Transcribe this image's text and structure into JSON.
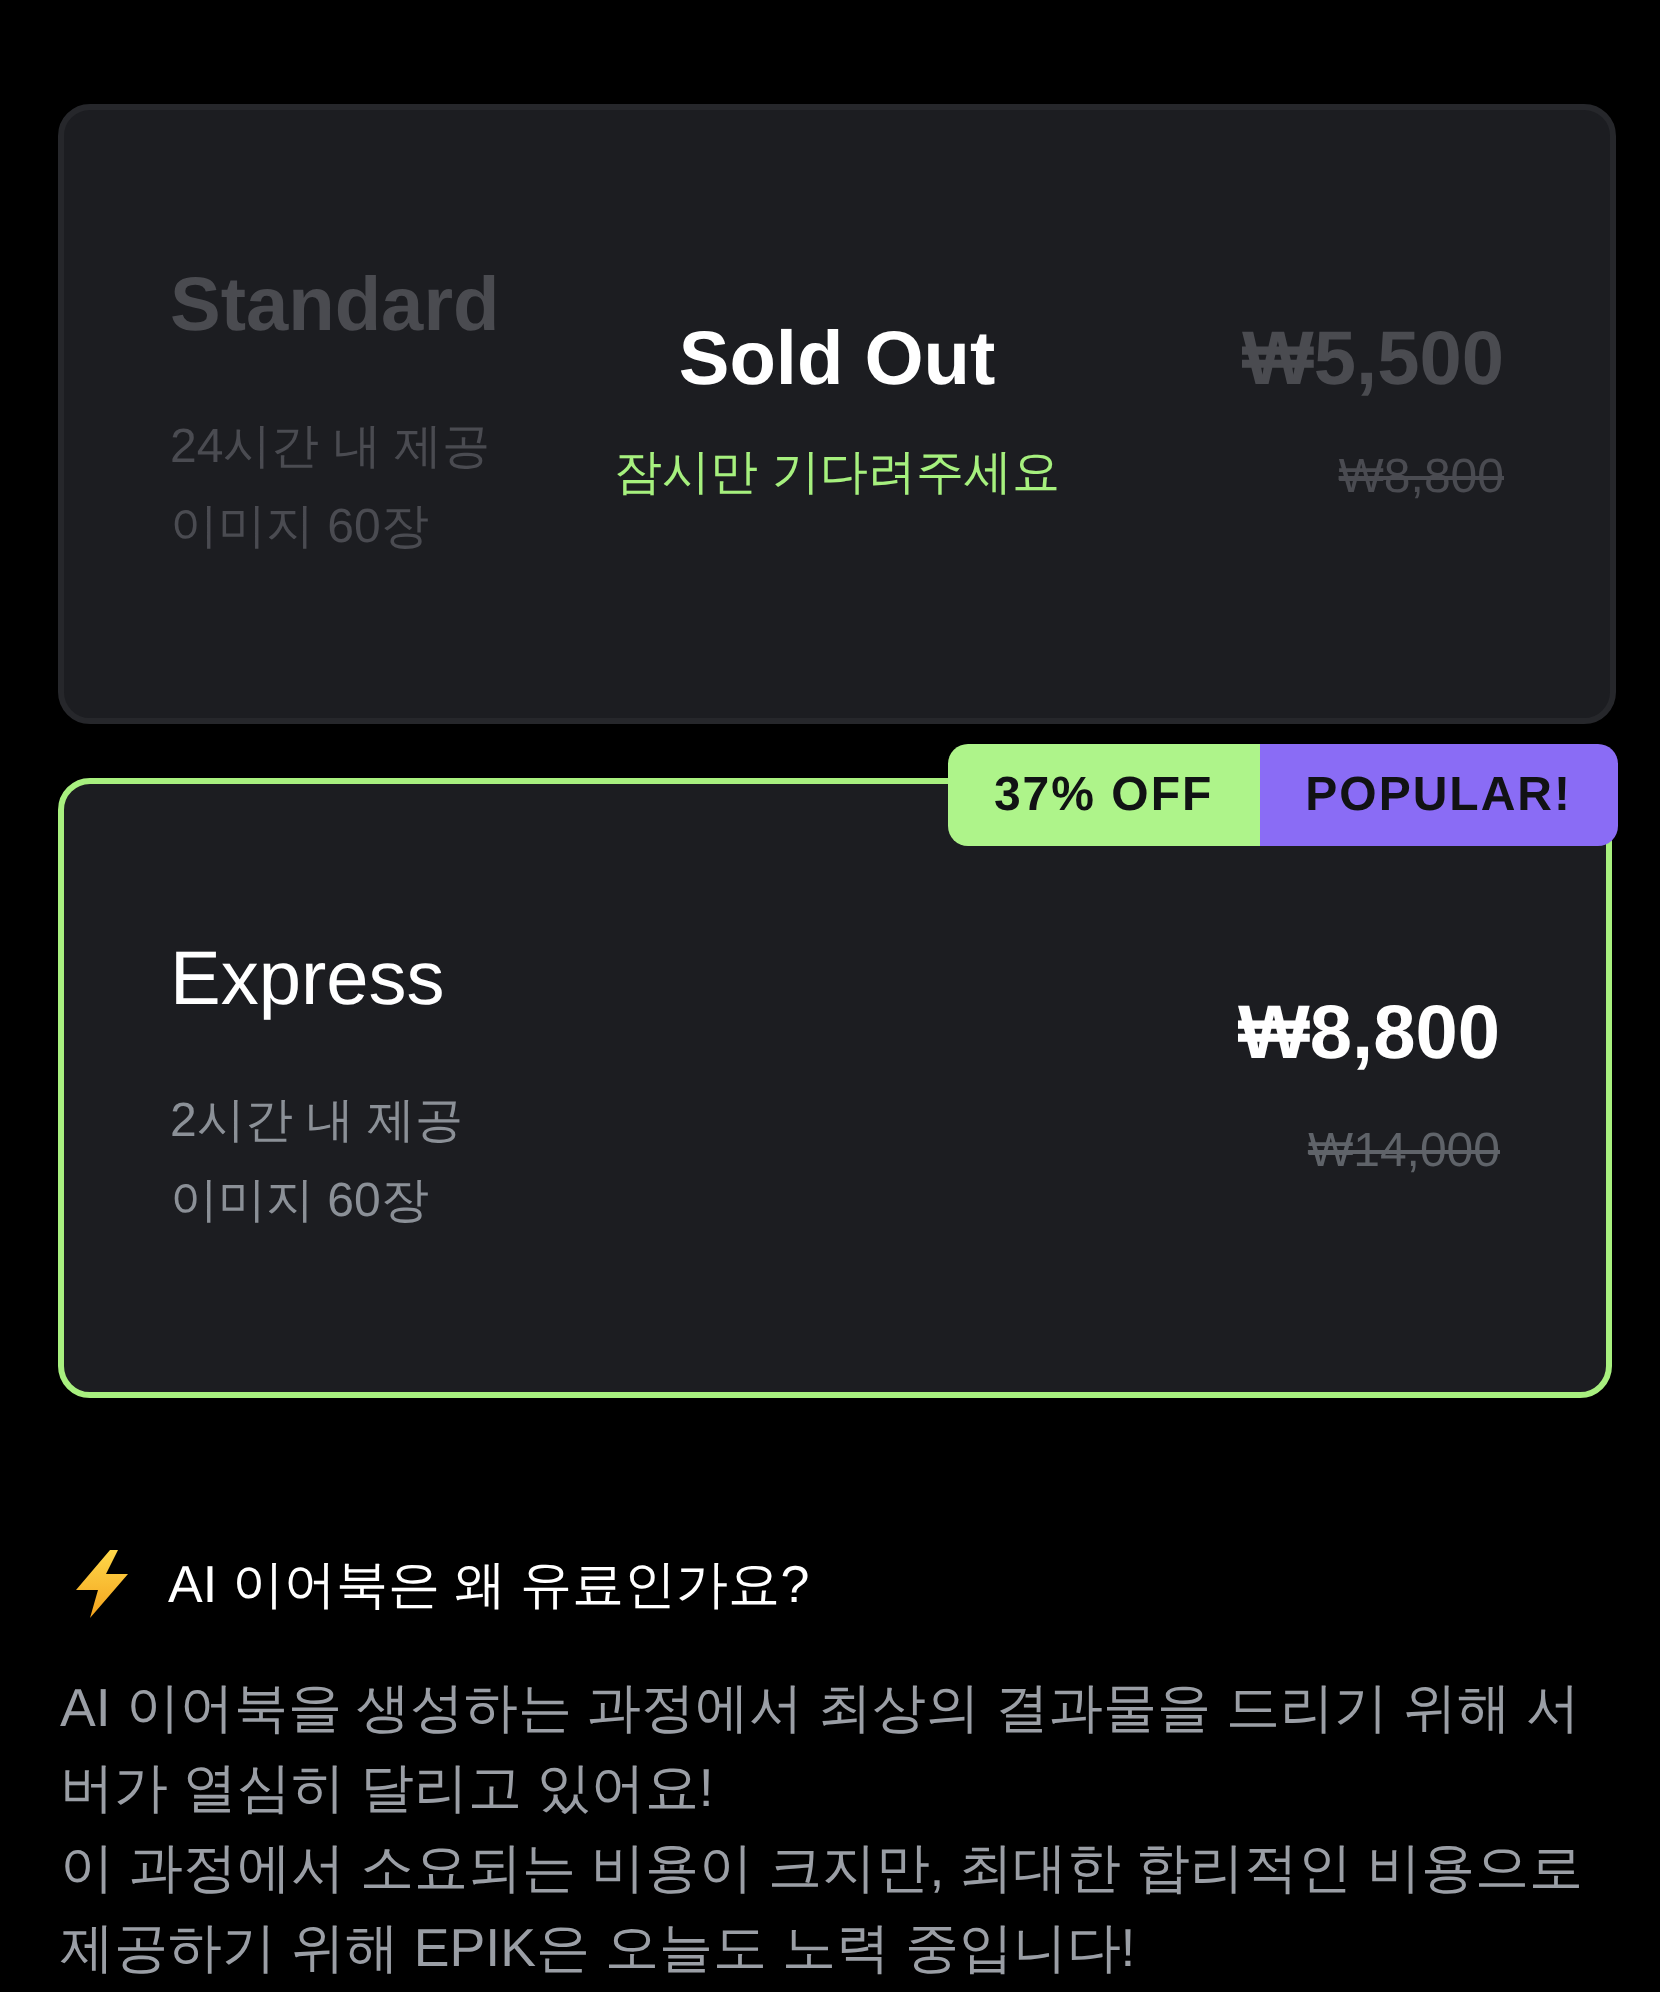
{
  "plans": [
    {
      "name": "Standard",
      "features": [
        "24시간 내 제공",
        "이미지 60장"
      ],
      "price": "₩5,500",
      "original_price": "₩8,800",
      "selected": false,
      "sold_out": true,
      "overlay": {
        "title": "Sold Out",
        "note": "잠시만 기다려주세요"
      }
    },
    {
      "name": "Express",
      "features": [
        "2시간 내 제공",
        "이미지 60장"
      ],
      "price": "₩8,800",
      "original_price": "₩14,000",
      "selected": true,
      "sold_out": false,
      "badges": [
        {
          "label": "37% OFF",
          "color": "#aef48a"
        },
        {
          "label": "POPULAR!",
          "color": "#8a6cf5"
        }
      ]
    }
  ],
  "info": {
    "title": "AI 이어북은 왜 유료인가요?",
    "paragraphs": [
      "AI 이어북을 생성하는 과정에서 최상의 결과물을 드리기 위해 서버가 열심히 달리고 있어요!",
      "이 과정에서 소요되는 비용이 크지만, 최대한 합리적인 비용으로 제공하기 위해 EPIK은 오늘도 노력 중입니다!"
    ]
  }
}
